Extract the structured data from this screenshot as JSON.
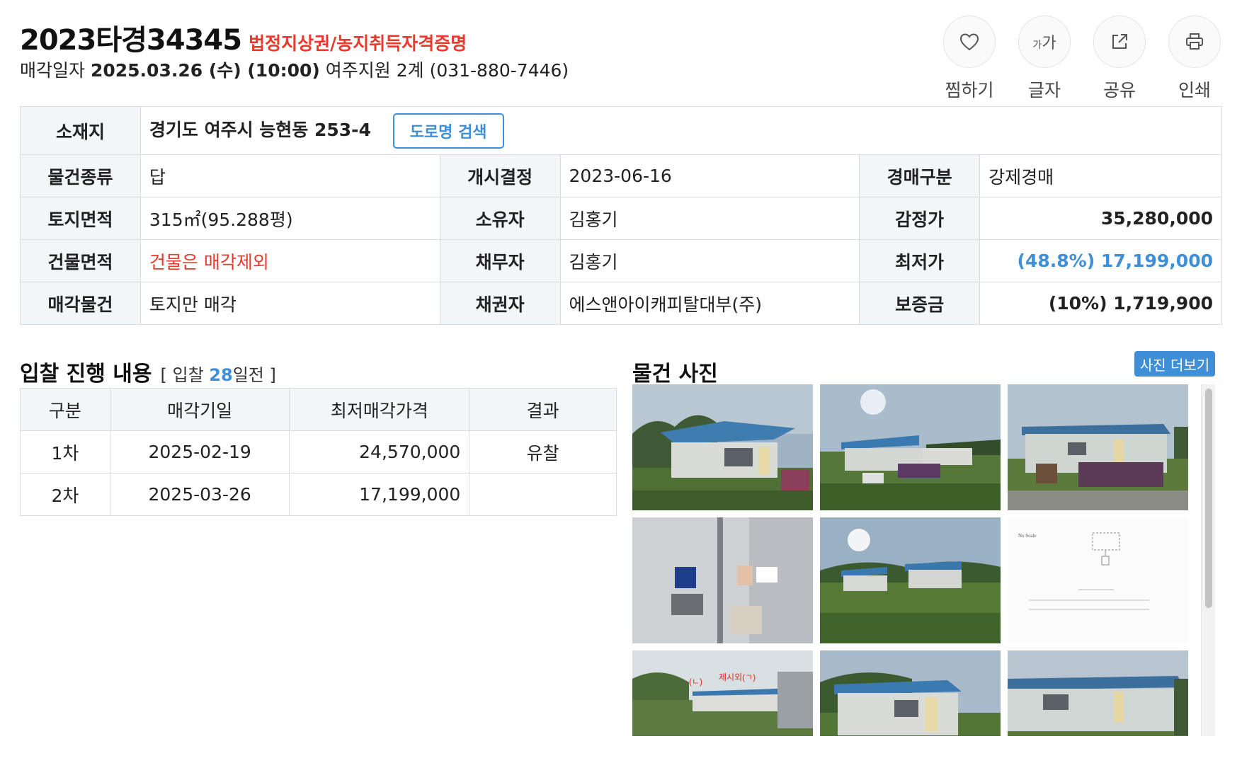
{
  "header": {
    "case_number": "2023타경34345",
    "case_tags": "법정지상권/농지취득자격증명",
    "sale_date_label": "매각일자",
    "sale_datetime": "2025.03.26 (수) (10:00)",
    "court": "여주지원 2계 (031-880-7446)"
  },
  "actions": [
    {
      "label": "찜하기",
      "icon": "heart-icon"
    },
    {
      "label": "글자",
      "icon": "font-size-icon",
      "glyph_small": "가",
      "glyph_large": "가"
    },
    {
      "label": "공유",
      "icon": "share-icon"
    },
    {
      "label": "인쇄",
      "icon": "print-icon"
    }
  ],
  "info": {
    "address_label": "소재지",
    "address": "경기도 여주시 능현동 253-4",
    "road_search_label": "도로명 검색",
    "rows": [
      {
        "l1": "물건종류",
        "v1": "답",
        "l2": "개시결정",
        "v2": "2023-06-16",
        "l3": "경매구분",
        "v3": "강제경매"
      },
      {
        "l1": "토지면적",
        "v1": "315㎡(95.288평)",
        "l2": "소유자",
        "v2": "김홍기",
        "l3": "감정가",
        "v3": "35,280,000"
      },
      {
        "l1": "건물면적",
        "v1": "건물은 매각제외",
        "l2": "채무자",
        "v2": "김홍기",
        "l3": "최저가",
        "v3": "(48.8%) 17,199,000"
      },
      {
        "l1": "매각물건",
        "v1": "토지만 매각",
        "l2": "채권자",
        "v2": "에스앤아이캐피탈대부(주)",
        "l3": "보증금",
        "v3": "(10%) 1,719,900"
      }
    ]
  },
  "bid": {
    "title": "입찰 진행 내용",
    "sub_prefix": "[ 입찰 ",
    "days": "28",
    "sub_suffix": "일전 ]",
    "headers": [
      "구분",
      "매각기일",
      "최저매각가격",
      "결과"
    ],
    "rows": [
      {
        "round": "1차",
        "date": "2025-02-19",
        "price": "24,570,000",
        "result": "유찰"
      },
      {
        "round": "2차",
        "date": "2025-03-26",
        "price": "17,199,000",
        "result": ""
      }
    ]
  },
  "photos": {
    "title": "물건 사진",
    "more_label": "사진 더보기",
    "overlay_label_1": "(ㄴ)",
    "overlay_label_2": "제시외(ㄱ)"
  },
  "colors": {
    "accent_blue": "#3e8fd8",
    "accent_red": "#e8392c"
  }
}
